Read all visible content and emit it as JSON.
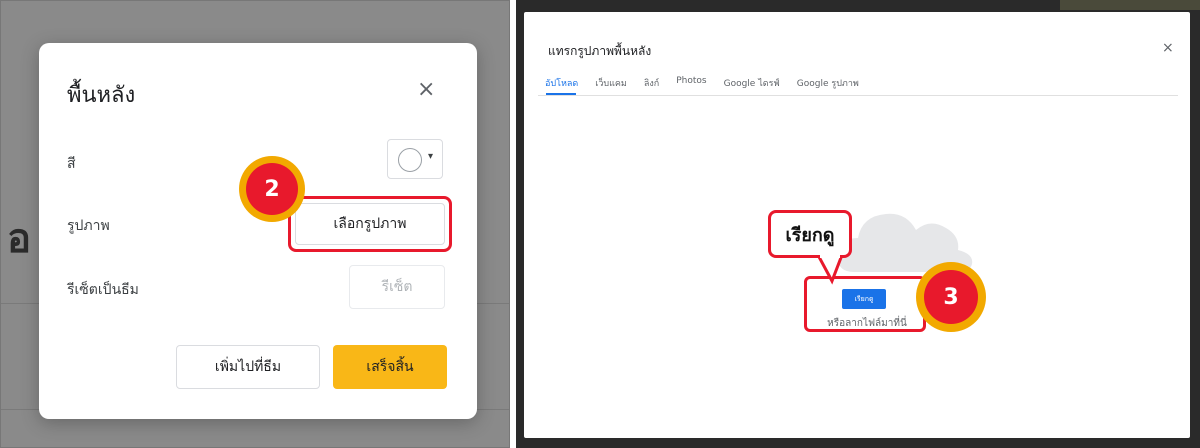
{
  "left": {
    "background_glyph": "อ",
    "dialog": {
      "title": "พื้นหลัง",
      "close_icon": "×",
      "color_label": "สี",
      "color_caret": "▾",
      "image_label": "รูปภาพ",
      "choose_image_label": "เลือกรูปภาพ",
      "reset_theme_label": "รีเซ็ตเป็นธีม",
      "reset_button_label": "รีเซ็ต",
      "add_to_theme_label": "เพิ่มไปที่ธีม",
      "done_label": "เสร็จสิ้น"
    },
    "step_badge": "2"
  },
  "right": {
    "picker": {
      "title": "แทรกรูปภาพพื้นหลัง",
      "close_icon": "×",
      "tabs": [
        {
          "label": "อัปโหลด",
          "active": true
        },
        {
          "label": "เว็บแคม",
          "active": false
        },
        {
          "label": "ลิงก์",
          "active": false
        },
        {
          "label": "Photos",
          "active": false
        },
        {
          "label": "Google ไดรฟ์",
          "active": false
        },
        {
          "label": "Google รูปภาพ",
          "active": false
        }
      ],
      "upload_button_label": "เรียกดู",
      "drag_text": "หรือลากไฟล์มาที่นี่"
    },
    "callout_text": "เรียกดู",
    "step_badge": "3"
  },
  "colors": {
    "highlight_red": "#e8192c",
    "badge_gold": "#f2a900",
    "done_yellow": "#f9b717",
    "google_blue": "#1a73e8"
  }
}
